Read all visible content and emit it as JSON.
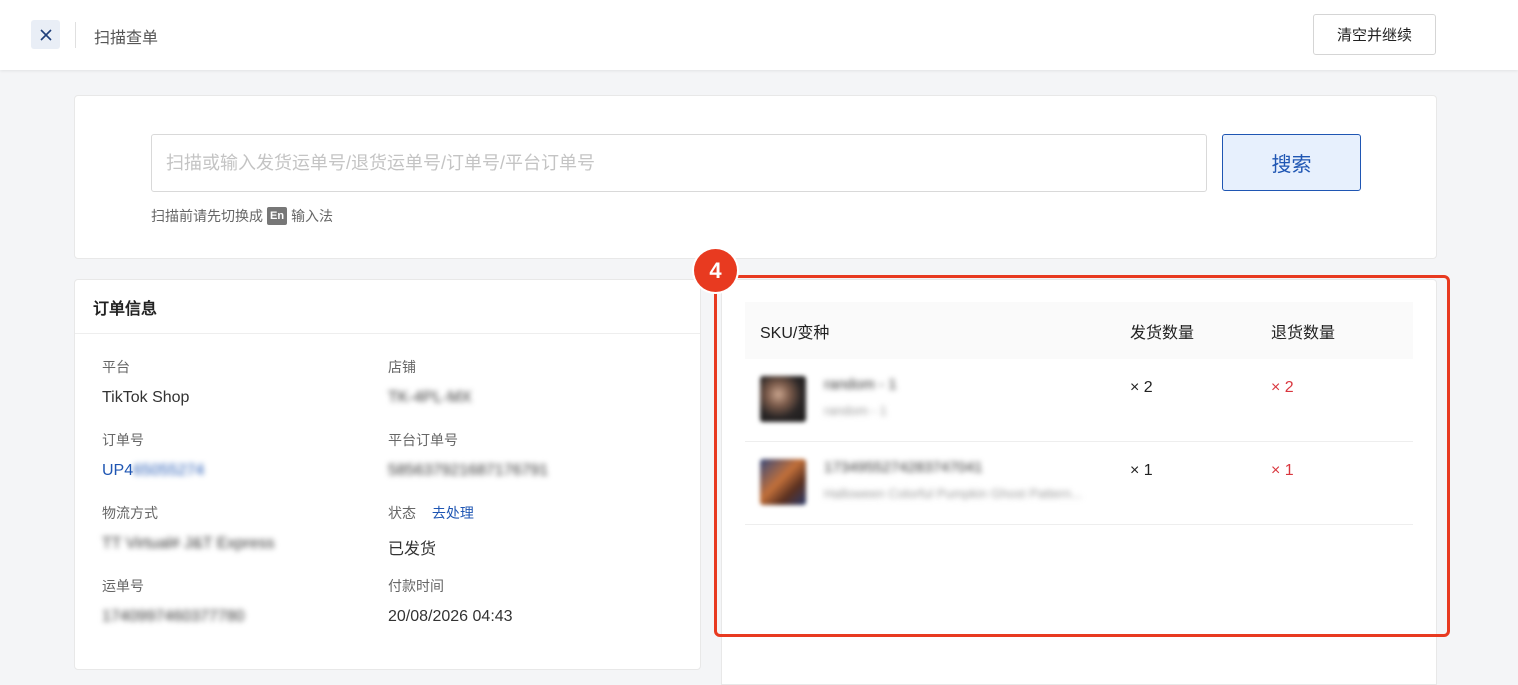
{
  "topbar": {
    "title": "扫描查单",
    "clear_label": "清空并继续"
  },
  "search": {
    "placeholder": "扫描或输入发货运单号/退货运单号/订单号/平台订单号",
    "button_label": "搜索",
    "hint_prefix": "扫描前请先切换成",
    "hint_badge": "En",
    "hint_suffix": "输入法"
  },
  "order": {
    "heading": "订单信息",
    "platform_label": "平台",
    "platform_value": "TikTok Shop",
    "store_label": "店铺",
    "store_value": "TK-4PL-MX",
    "order_no_label": "订单号",
    "order_no_prefix": "UP4",
    "order_no_rest": "65055274",
    "platform_order_label": "平台订单号",
    "platform_order_value": "585637921687176791",
    "logistics_label": "物流方式",
    "logistics_value": "TT Virtual# J&T Express",
    "status_label": "状态",
    "status_action": "去处理",
    "status_value": "已发货",
    "waybill_label": "运单号",
    "waybill_value": "1740997460377780",
    "paid_label": "付款时间",
    "paid_value": "20/08/2026 04:43"
  },
  "step_badge": "4",
  "sku_table": {
    "headers": [
      "SKU/变种",
      "发货数量",
      "退货数量"
    ],
    "rows": [
      {
        "name": "random - 1",
        "sub": "random - 1",
        "ship_qty": "× 2",
        "return_qty": "× 2"
      },
      {
        "name": "1734955274283747041",
        "sub": "Halloween Colorful Pumpkin Ghost Pattern...",
        "ship_qty": "× 1",
        "return_qty": "× 1"
      }
    ]
  },
  "colors": {
    "accent": "#1f56b3",
    "highlight": "#e83a20",
    "return_red": "#d9363e"
  }
}
